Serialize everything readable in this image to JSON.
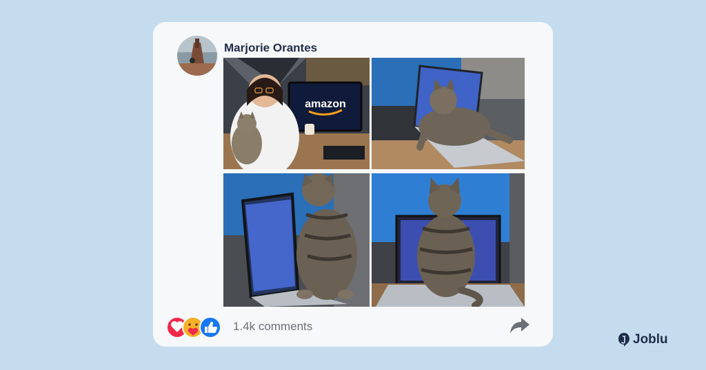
{
  "post": {
    "author": "Marjorie Orantes",
    "comments": "1.4k comments",
    "photos": [
      {
        "label": "woman-with-cat-amazon-monitor",
        "monitor_text": "amazon"
      },
      {
        "label": "cat-on-laptop-side-view"
      },
      {
        "label": "cat-beside-laptop-screen"
      },
      {
        "label": "cat-back-on-laptop"
      }
    ],
    "reactions": [
      "love-reaction-icon",
      "care-reaction-icon",
      "like-reaction-icon"
    ]
  },
  "brand": {
    "name": "Joblu"
  },
  "colors": {
    "background": "#c5dcef",
    "card": "#f7f8fa",
    "author": "#1f2d4a",
    "like": "#1877f2",
    "love": "#f0284a",
    "care": "#f7b125"
  }
}
